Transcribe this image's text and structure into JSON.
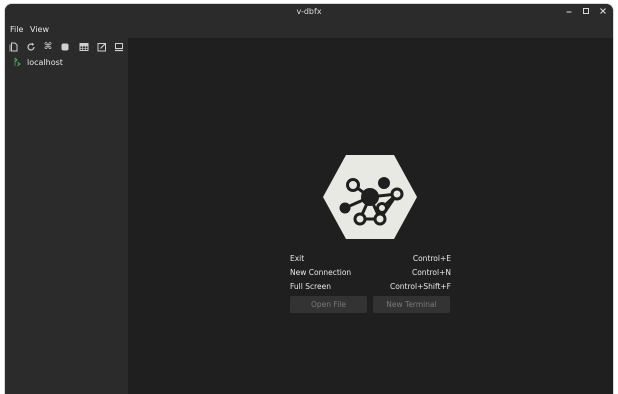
{
  "window": {
    "title": "v-dbfx"
  },
  "menubar": {
    "items": [
      {
        "label": "File"
      },
      {
        "label": "View"
      }
    ]
  },
  "toolbar": {
    "icons": [
      "new-file-icon",
      "refresh-icon",
      "command-icon",
      "stop-icon",
      "table-icon",
      "edit-icon",
      "terminal-icon"
    ]
  },
  "tree": {
    "items": [
      {
        "label": "localhost",
        "icon": "server-icon",
        "icon_color": "#3fae5a"
      }
    ]
  },
  "welcome": {
    "shortcuts": [
      {
        "label": "Exit",
        "key": "Control+E"
      },
      {
        "label": "New Connection",
        "key": "Control+N"
      },
      {
        "label": "Full Screen",
        "key": "Control+Shift+F"
      }
    ],
    "buttons": {
      "open_file": "Open File",
      "new_terminal": "New Terminal"
    }
  },
  "colors": {
    "sidebar_bg": "#2b2b2b",
    "main_bg": "#1f1f1f",
    "logo_bg": "#e9e9e4",
    "logo_fg": "#1f1f1f"
  }
}
